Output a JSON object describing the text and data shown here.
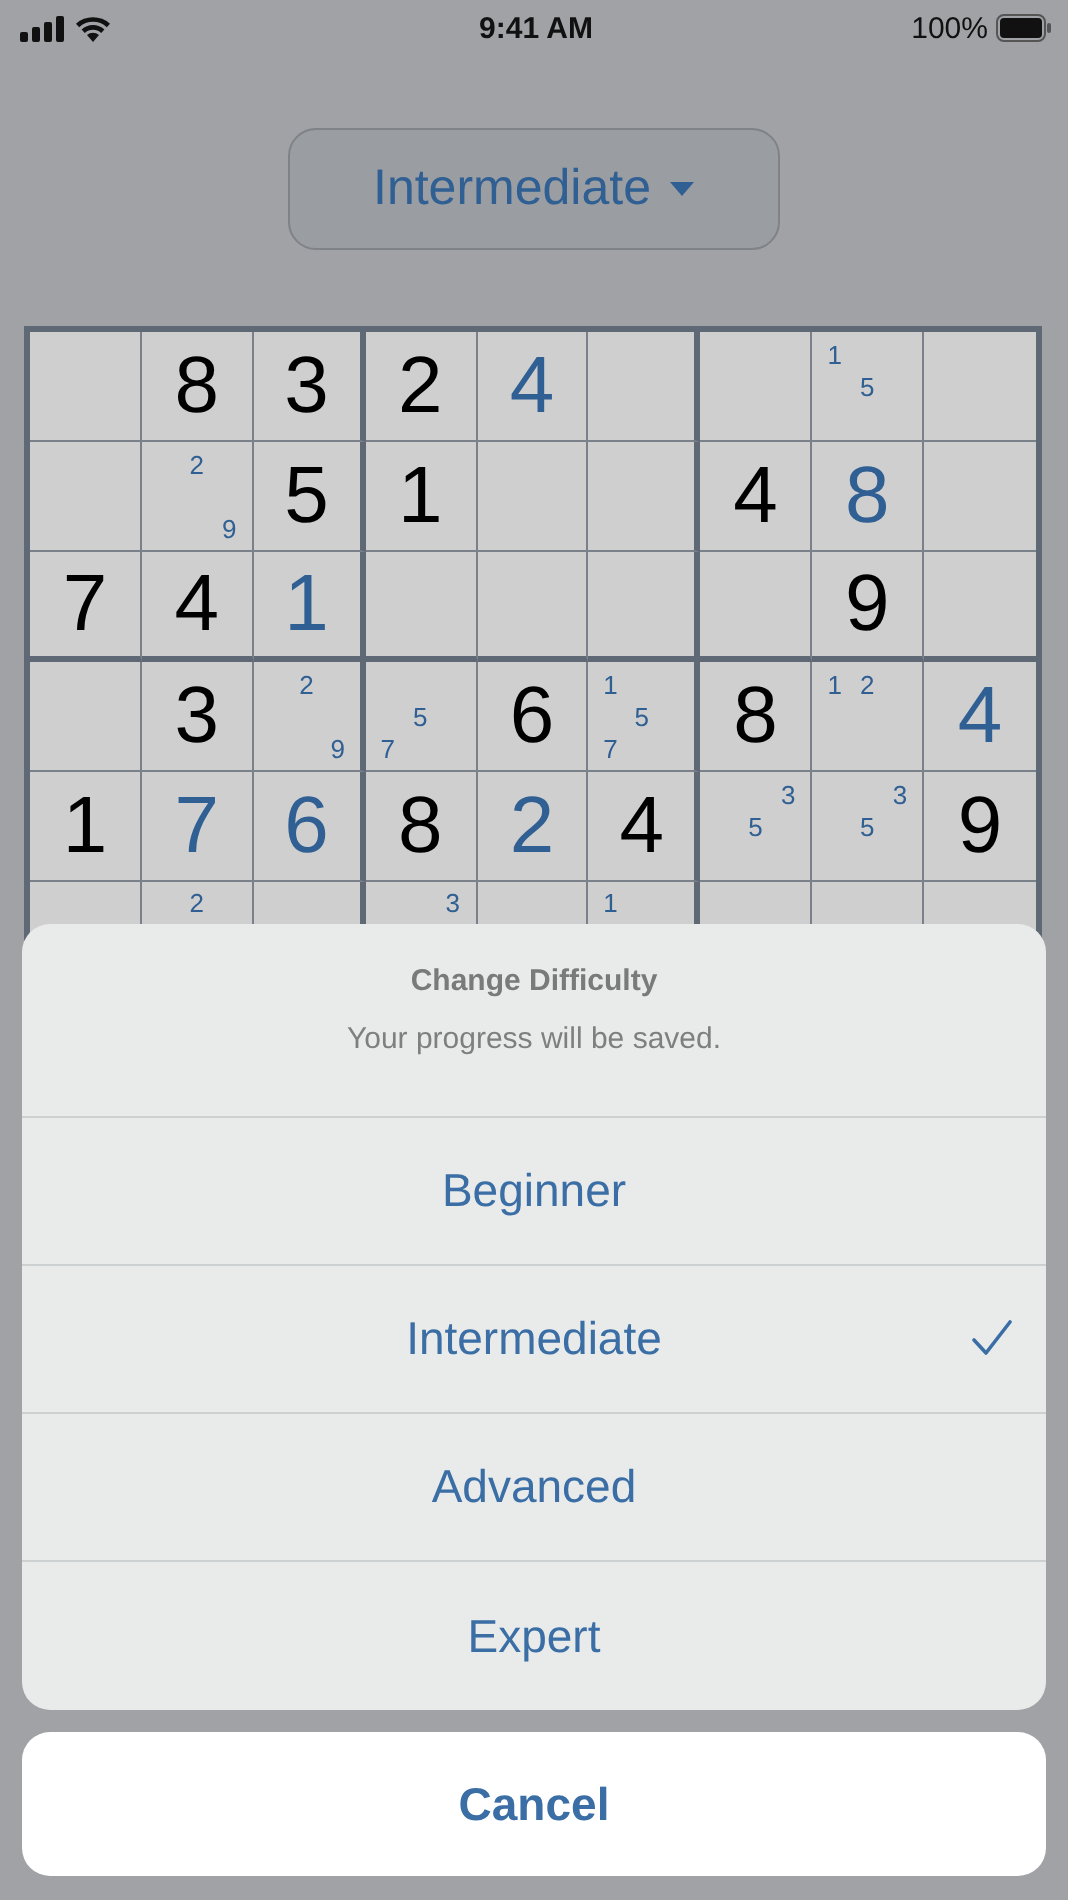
{
  "status_bar": {
    "time": "9:41 AM",
    "battery": "100%"
  },
  "difficulty_button": {
    "label": "Intermediate"
  },
  "grid": {
    "rows": [
      [
        {
          "kind": "empty"
        },
        {
          "kind": "given",
          "value": "8"
        },
        {
          "kind": "given",
          "value": "3"
        },
        {
          "kind": "given",
          "value": "2"
        },
        {
          "kind": "entered",
          "value": "4"
        },
        {
          "kind": "empty"
        },
        {
          "kind": "empty"
        },
        {
          "kind": "notes",
          "note_rows": [
            [
              "1",
              null,
              null
            ],
            [
              null,
              "5",
              null
            ]
          ]
        },
        {
          "kind": "empty"
        }
      ],
      [
        {
          "kind": "empty"
        },
        {
          "kind": "notes",
          "note_rows": [
            [
              null,
              "2",
              null
            ],
            [
              null,
              null,
              null
            ],
            [
              null,
              null,
              "9"
            ]
          ]
        },
        {
          "kind": "given",
          "value": "5"
        },
        {
          "kind": "given",
          "value": "1"
        },
        {
          "kind": "empty"
        },
        {
          "kind": "empty"
        },
        {
          "kind": "given",
          "value": "4"
        },
        {
          "kind": "entered",
          "value": "8"
        },
        {
          "kind": "empty"
        }
      ],
      [
        {
          "kind": "given",
          "value": "7"
        },
        {
          "kind": "given",
          "value": "4"
        },
        {
          "kind": "entered",
          "value": "1"
        },
        {
          "kind": "empty"
        },
        {
          "kind": "empty"
        },
        {
          "kind": "empty"
        },
        {
          "kind": "empty"
        },
        {
          "kind": "given",
          "value": "9"
        },
        {
          "kind": "empty"
        }
      ],
      [
        {
          "kind": "empty"
        },
        {
          "kind": "given",
          "value": "3"
        },
        {
          "kind": "notes",
          "note_rows": [
            [
              null,
              "2",
              null
            ],
            [
              null,
              null,
              null
            ],
            [
              null,
              null,
              "9"
            ]
          ]
        },
        {
          "kind": "notes",
          "note_rows": [
            [
              null,
              null,
              null
            ],
            [
              null,
              "5",
              null
            ],
            [
              "7",
              null,
              null
            ]
          ]
        },
        {
          "kind": "given",
          "value": "6"
        },
        {
          "kind": "notes",
          "note_rows": [
            [
              "1",
              null,
              null
            ],
            [
              null,
              "5",
              null
            ],
            [
              "7",
              null,
              null
            ]
          ]
        },
        {
          "kind": "given",
          "value": "8"
        },
        {
          "kind": "notes",
          "note_rows": [
            [
              "1",
              "2",
              null
            ]
          ]
        },
        {
          "kind": "entered",
          "value": "4"
        }
      ],
      [
        {
          "kind": "given",
          "value": "1"
        },
        {
          "kind": "entered",
          "value": "7"
        },
        {
          "kind": "entered",
          "value": "6"
        },
        {
          "kind": "given",
          "value": "8"
        },
        {
          "kind": "entered",
          "value": "2"
        },
        {
          "kind": "given",
          "value": "4"
        },
        {
          "kind": "notes",
          "note_rows": [
            [
              null,
              null,
              "3"
            ],
            [
              null,
              "5",
              null
            ]
          ]
        },
        {
          "kind": "notes",
          "note_rows": [
            [
              null,
              null,
              "3"
            ],
            [
              null,
              "5",
              null
            ]
          ]
        },
        {
          "kind": "given",
          "value": "9"
        }
      ],
      [
        {
          "kind": "empty"
        },
        {
          "kind": "notes",
          "note_rows": [
            [
              null,
              "2",
              null
            ]
          ]
        },
        {
          "kind": "empty"
        },
        {
          "kind": "notes",
          "note_rows": [
            [
              null,
              null,
              "3"
            ]
          ]
        },
        {
          "kind": "empty"
        },
        {
          "kind": "notes",
          "note_rows": [
            [
              "1",
              null,
              null
            ]
          ]
        },
        {
          "kind": "empty"
        },
        {
          "kind": "empty"
        },
        {
          "kind": "empty"
        }
      ]
    ]
  },
  "action_sheet": {
    "title": "Change Difficulty",
    "message": "Your progress will be saved.",
    "options": [
      {
        "label": "Beginner",
        "selected": false
      },
      {
        "label": "Intermediate",
        "selected": true
      },
      {
        "label": "Advanced",
        "selected": false
      },
      {
        "label": "Expert",
        "selected": false
      }
    ],
    "cancel": "Cancel"
  }
}
